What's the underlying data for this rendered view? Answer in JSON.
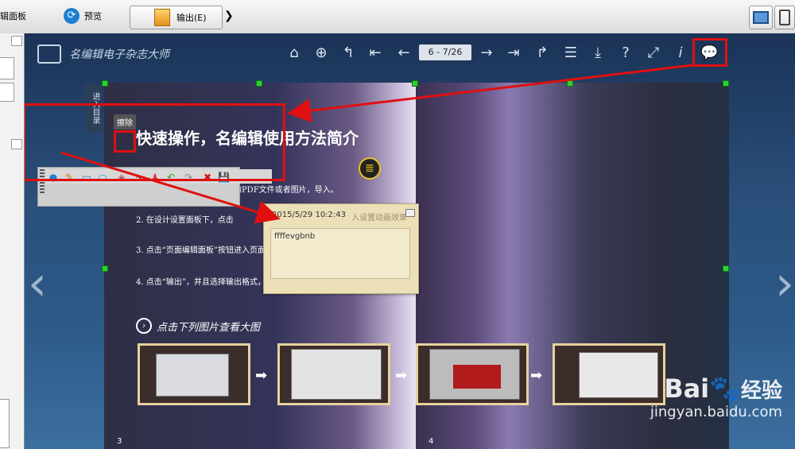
{
  "toolbar": {
    "cut_tab": "辑面板",
    "preview_label": "预览",
    "output_label": "输出(E)",
    "forward_glyph": "❯"
  },
  "viewer": {
    "logo_text": "名编辑电子杂志大师",
    "page_indicator": "6 - 7/26",
    "side_tab": "进入目录"
  },
  "left_page": {
    "title": "快速操作，名编辑使用方法简介",
    "steps": [
      "1. 点击“新建”按钮，打开您的PDF文件或者图片，导入。",
      "2. 在设计设置面板下，点击",
      "3. 点击“页面编辑面板”按钮进入页面管理器，添加文本/视频/音频/超链接/图片等。",
      "4. 点击“输出”，并且选择输出格式，转换。"
    ],
    "section": "点击下列图片查看大图",
    "page_no": "3"
  },
  "right_page": {
    "page_no": "4"
  },
  "annotation_toolbar": {
    "tooltip": "擦除",
    "tools": [
      "comment-icon",
      "pencil-icon",
      "rectangle-icon",
      "ellipse-icon",
      "eraser-icon",
      "select-icon",
      "stamp-icon",
      "undo-icon",
      "redo-icon",
      "delete-icon",
      "save-icon"
    ]
  },
  "note": {
    "timestamp": "2015/5/29 10:2:43",
    "content": "ffffevgbnb",
    "behind_text": "入设置动画效果"
  },
  "watermark": {
    "brand": "Bai",
    "brand2": "经验",
    "url": "jingyan.baidu.com"
  },
  "colors": {
    "highlight": "#e01010",
    "handle": "#2fd12f"
  }
}
